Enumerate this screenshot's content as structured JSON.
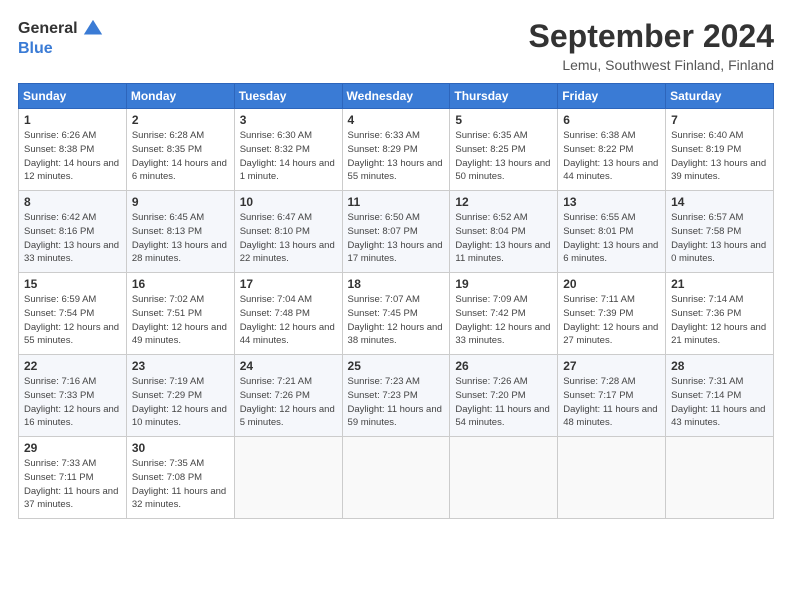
{
  "logo": {
    "general": "General",
    "blue": "Blue"
  },
  "title": "September 2024",
  "location": "Lemu, Southwest Finland, Finland",
  "days_of_week": [
    "Sunday",
    "Monday",
    "Tuesday",
    "Wednesday",
    "Thursday",
    "Friday",
    "Saturday"
  ],
  "weeks": [
    [
      {
        "day": "1",
        "sunrise": "Sunrise: 6:26 AM",
        "sunset": "Sunset: 8:38 PM",
        "daylight": "Daylight: 14 hours and 12 minutes."
      },
      {
        "day": "2",
        "sunrise": "Sunrise: 6:28 AM",
        "sunset": "Sunset: 8:35 PM",
        "daylight": "Daylight: 14 hours and 6 minutes."
      },
      {
        "day": "3",
        "sunrise": "Sunrise: 6:30 AM",
        "sunset": "Sunset: 8:32 PM",
        "daylight": "Daylight: 14 hours and 1 minute."
      },
      {
        "day": "4",
        "sunrise": "Sunrise: 6:33 AM",
        "sunset": "Sunset: 8:29 PM",
        "daylight": "Daylight: 13 hours and 55 minutes."
      },
      {
        "day": "5",
        "sunrise": "Sunrise: 6:35 AM",
        "sunset": "Sunset: 8:25 PM",
        "daylight": "Daylight: 13 hours and 50 minutes."
      },
      {
        "day": "6",
        "sunrise": "Sunrise: 6:38 AM",
        "sunset": "Sunset: 8:22 PM",
        "daylight": "Daylight: 13 hours and 44 minutes."
      },
      {
        "day": "7",
        "sunrise": "Sunrise: 6:40 AM",
        "sunset": "Sunset: 8:19 PM",
        "daylight": "Daylight: 13 hours and 39 minutes."
      }
    ],
    [
      {
        "day": "8",
        "sunrise": "Sunrise: 6:42 AM",
        "sunset": "Sunset: 8:16 PM",
        "daylight": "Daylight: 13 hours and 33 minutes."
      },
      {
        "day": "9",
        "sunrise": "Sunrise: 6:45 AM",
        "sunset": "Sunset: 8:13 PM",
        "daylight": "Daylight: 13 hours and 28 minutes."
      },
      {
        "day": "10",
        "sunrise": "Sunrise: 6:47 AM",
        "sunset": "Sunset: 8:10 PM",
        "daylight": "Daylight: 13 hours and 22 minutes."
      },
      {
        "day": "11",
        "sunrise": "Sunrise: 6:50 AM",
        "sunset": "Sunset: 8:07 PM",
        "daylight": "Daylight: 13 hours and 17 minutes."
      },
      {
        "day": "12",
        "sunrise": "Sunrise: 6:52 AM",
        "sunset": "Sunset: 8:04 PM",
        "daylight": "Daylight: 13 hours and 11 minutes."
      },
      {
        "day": "13",
        "sunrise": "Sunrise: 6:55 AM",
        "sunset": "Sunset: 8:01 PM",
        "daylight": "Daylight: 13 hours and 6 minutes."
      },
      {
        "day": "14",
        "sunrise": "Sunrise: 6:57 AM",
        "sunset": "Sunset: 7:58 PM",
        "daylight": "Daylight: 13 hours and 0 minutes."
      }
    ],
    [
      {
        "day": "15",
        "sunrise": "Sunrise: 6:59 AM",
        "sunset": "Sunset: 7:54 PM",
        "daylight": "Daylight: 12 hours and 55 minutes."
      },
      {
        "day": "16",
        "sunrise": "Sunrise: 7:02 AM",
        "sunset": "Sunset: 7:51 PM",
        "daylight": "Daylight: 12 hours and 49 minutes."
      },
      {
        "day": "17",
        "sunrise": "Sunrise: 7:04 AM",
        "sunset": "Sunset: 7:48 PM",
        "daylight": "Daylight: 12 hours and 44 minutes."
      },
      {
        "day": "18",
        "sunrise": "Sunrise: 7:07 AM",
        "sunset": "Sunset: 7:45 PM",
        "daylight": "Daylight: 12 hours and 38 minutes."
      },
      {
        "day": "19",
        "sunrise": "Sunrise: 7:09 AM",
        "sunset": "Sunset: 7:42 PM",
        "daylight": "Daylight: 12 hours and 33 minutes."
      },
      {
        "day": "20",
        "sunrise": "Sunrise: 7:11 AM",
        "sunset": "Sunset: 7:39 PM",
        "daylight": "Daylight: 12 hours and 27 minutes."
      },
      {
        "day": "21",
        "sunrise": "Sunrise: 7:14 AM",
        "sunset": "Sunset: 7:36 PM",
        "daylight": "Daylight: 12 hours and 21 minutes."
      }
    ],
    [
      {
        "day": "22",
        "sunrise": "Sunrise: 7:16 AM",
        "sunset": "Sunset: 7:33 PM",
        "daylight": "Daylight: 12 hours and 16 minutes."
      },
      {
        "day": "23",
        "sunrise": "Sunrise: 7:19 AM",
        "sunset": "Sunset: 7:29 PM",
        "daylight": "Daylight: 12 hours and 10 minutes."
      },
      {
        "day": "24",
        "sunrise": "Sunrise: 7:21 AM",
        "sunset": "Sunset: 7:26 PM",
        "daylight": "Daylight: 12 hours and 5 minutes."
      },
      {
        "day": "25",
        "sunrise": "Sunrise: 7:23 AM",
        "sunset": "Sunset: 7:23 PM",
        "daylight": "Daylight: 11 hours and 59 minutes."
      },
      {
        "day": "26",
        "sunrise": "Sunrise: 7:26 AM",
        "sunset": "Sunset: 7:20 PM",
        "daylight": "Daylight: 11 hours and 54 minutes."
      },
      {
        "day": "27",
        "sunrise": "Sunrise: 7:28 AM",
        "sunset": "Sunset: 7:17 PM",
        "daylight": "Daylight: 11 hours and 48 minutes."
      },
      {
        "day": "28",
        "sunrise": "Sunrise: 7:31 AM",
        "sunset": "Sunset: 7:14 PM",
        "daylight": "Daylight: 11 hours and 43 minutes."
      }
    ],
    [
      {
        "day": "29",
        "sunrise": "Sunrise: 7:33 AM",
        "sunset": "Sunset: 7:11 PM",
        "daylight": "Daylight: 11 hours and 37 minutes."
      },
      {
        "day": "30",
        "sunrise": "Sunrise: 7:35 AM",
        "sunset": "Sunset: 7:08 PM",
        "daylight": "Daylight: 11 hours and 32 minutes."
      },
      null,
      null,
      null,
      null,
      null
    ]
  ]
}
